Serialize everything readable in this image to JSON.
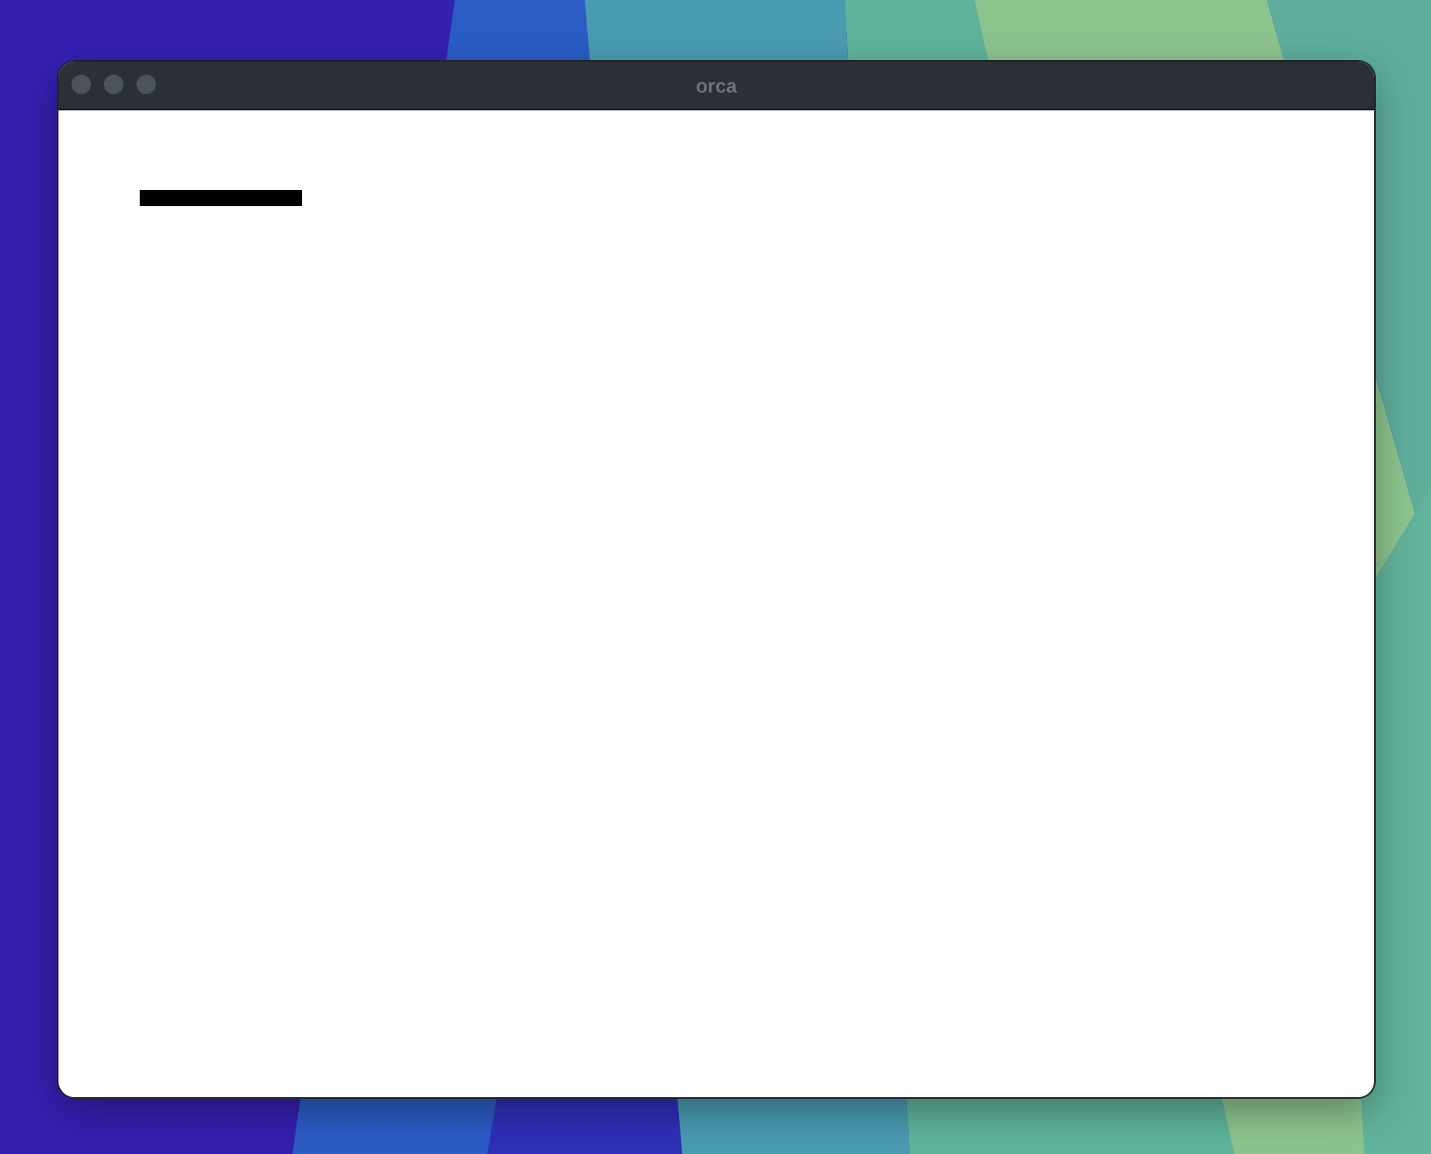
{
  "window": {
    "title": "orca"
  }
}
